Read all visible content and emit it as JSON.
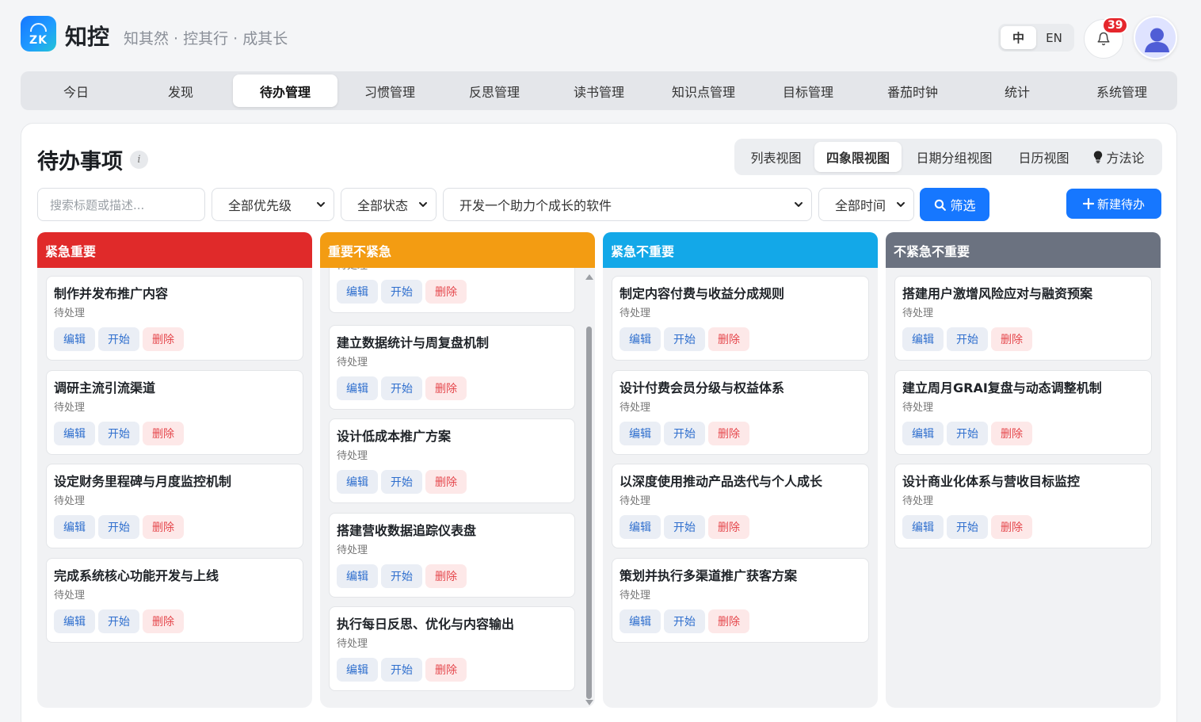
{
  "header": {
    "logo_text": "ZK",
    "app_name": "知控",
    "slogan": "知其然 · 控其行 · 成其长",
    "lang_options": [
      "中",
      "EN"
    ],
    "notification_count": "39"
  },
  "nav": {
    "items": [
      "今日",
      "发现",
      "待办管理",
      "习惯管理",
      "反思管理",
      "读书管理",
      "知识点管理",
      "目标管理",
      "番茄时钟",
      "统计",
      "系统管理"
    ],
    "active": "待办管理"
  },
  "page": {
    "title": "待办事项",
    "info_icon": "i",
    "views": [
      "列表视图",
      "四象限视图",
      "日期分组视图",
      "日历视图",
      "方法论"
    ],
    "active_view": "四象限视图"
  },
  "filters": {
    "search_placeholder": "搜索标题或描述...",
    "priority": "全部优先级",
    "status": "全部状态",
    "goal": "开发一个助力个成长的软件",
    "time": "全部时间",
    "filter_button": "筛选",
    "new_button": "新建待办"
  },
  "actions": {
    "edit": "编辑",
    "start": "开始",
    "delete": "删除"
  },
  "quadrants": [
    {
      "name": "紧急重要",
      "color": "#e02a2a",
      "tasks": [
        {
          "title": "制作并发布推广内容",
          "status": "待处理"
        },
        {
          "title": "调研主流引流渠道",
          "status": "待处理"
        },
        {
          "title": "设定财务里程碑与月度监控机制",
          "status": "待处理"
        },
        {
          "title": "完成系统核心功能开发与上线",
          "status": "待处理"
        }
      ]
    },
    {
      "name": "重要不紧急",
      "color": "#f39c12",
      "tasks": [
        {
          "title": "",
          "status": "待处理"
        },
        {
          "title": "建立数据统计与周复盘机制",
          "status": "待处理"
        },
        {
          "title": "设计低成本推广方案",
          "status": "待处理"
        },
        {
          "title": "搭建营收数据追踪仪表盘",
          "status": "待处理"
        },
        {
          "title": "执行每日反思、优化与内容输出",
          "status": "待处理"
        }
      ]
    },
    {
      "name": "紧急不重要",
      "color": "#13a8e8",
      "tasks": [
        {
          "title": "制定内容付费与收益分成规则",
          "status": "待处理"
        },
        {
          "title": "设计付费会员分级与权益体系",
          "status": "待处理"
        },
        {
          "title": "以深度使用推动产品迭代与个人成长",
          "status": "待处理"
        },
        {
          "title": "策划并执行多渠道推广获客方案",
          "status": "待处理"
        }
      ]
    },
    {
      "name": "不紧急不重要",
      "color": "#6b7280",
      "tasks": [
        {
          "title": "搭建用户激增风险应对与融资预案",
          "status": "待处理"
        },
        {
          "title": "建立周月GRAI复盘与动态调整机制",
          "status": "待处理"
        },
        {
          "title": "设计商业化体系与营收目标监控",
          "status": "待处理"
        }
      ]
    }
  ]
}
